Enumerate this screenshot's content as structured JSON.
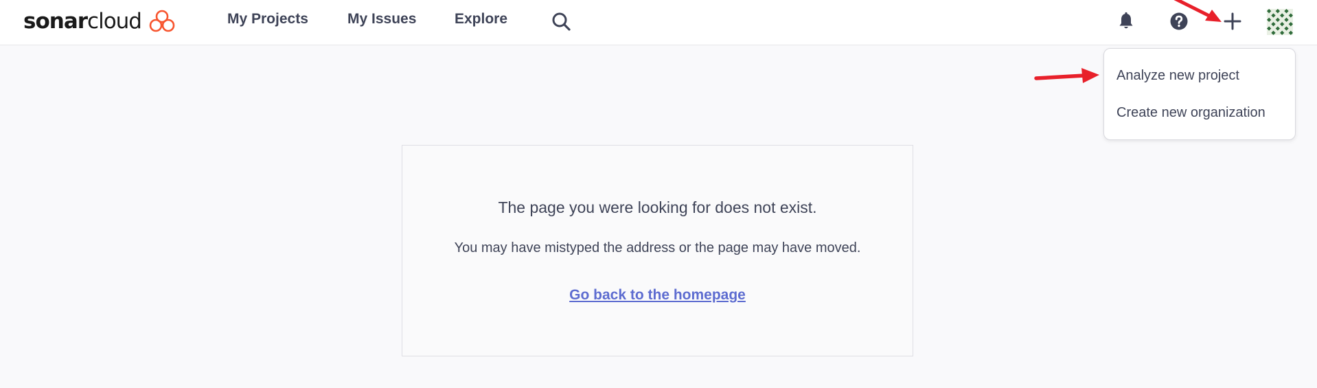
{
  "brand": {
    "name_bold": "sonar",
    "name_light": "cloud",
    "logo_color": "#f7542e"
  },
  "nav": {
    "items": [
      {
        "label": "My Projects"
      },
      {
        "label": "My Issues"
      },
      {
        "label": "Explore"
      }
    ],
    "search_icon": "search-icon"
  },
  "toolbar": {
    "notifications_icon": "bell-icon",
    "help_icon": "help-icon",
    "add_icon": "plus-icon",
    "avatar_icon": "avatar"
  },
  "create_menu": {
    "items": [
      {
        "label": "Analyze new project"
      },
      {
        "label": "Create new organization"
      }
    ]
  },
  "not_found": {
    "title": "The page you were looking for does not exist.",
    "message": "You may have mistyped the address or the page may have moved.",
    "link_label": "Go back to the homepage",
    "link_color": "#5d6cd0"
  },
  "annotations": {
    "arrow_color": "#e8202a"
  }
}
